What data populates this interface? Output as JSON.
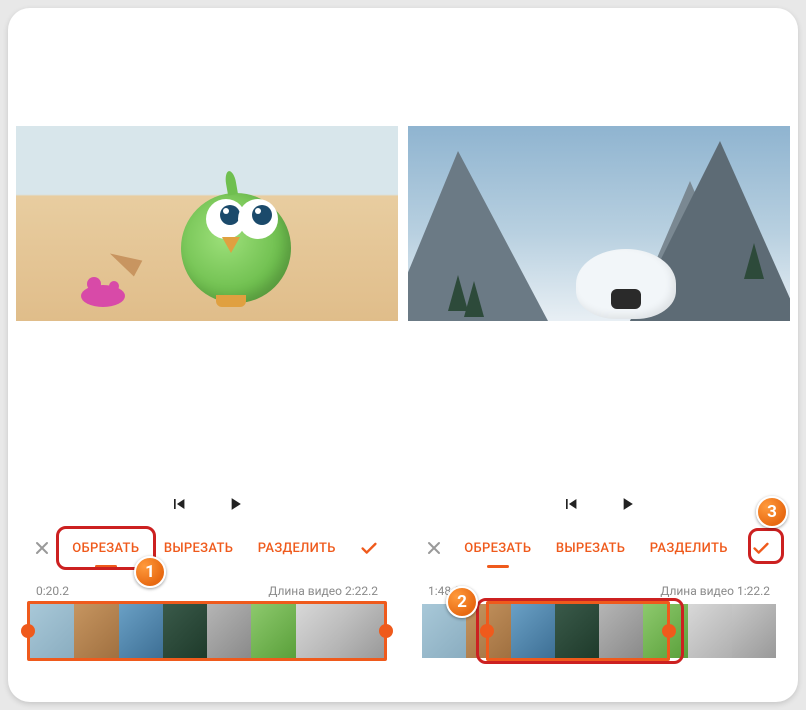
{
  "colors": {
    "accent": "#ef5a1c",
    "callout": "#cc2020"
  },
  "icons": {
    "close": "×",
    "check": "✓",
    "prev": "skip-previous",
    "play": "play"
  },
  "tabs": {
    "crop": "ОБРЕЗАТЬ",
    "cut": "ВЫРЕЗАТЬ",
    "split": "РАЗДЕЛИТЬ"
  },
  "badges": {
    "one": "1",
    "two": "2",
    "three": "3"
  },
  "left": {
    "active_tab": "crop",
    "time_current": "0:20.2",
    "time_total_label": "Длина видео 2:22.2"
  },
  "right": {
    "active_tab": "crop",
    "time_current": "1:48.2",
    "time_total_label": "Длина видео 1:22.2"
  }
}
